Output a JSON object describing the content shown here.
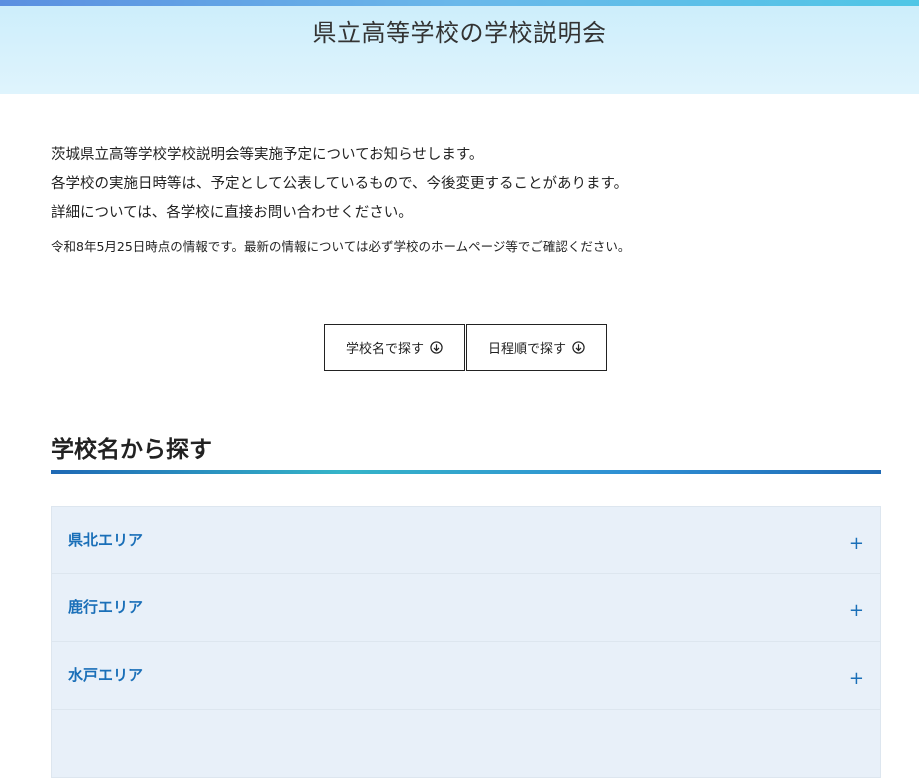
{
  "header": {
    "title": "県立高等学校の学校説明会"
  },
  "intro": {
    "line1": "茨城県立高等学校学校説明会等実施予定についてお知らせします。",
    "line2": "各学校の実施日時等は、予定として公表しているもので、今後変更することがあります。",
    "line3": "詳細については、各学校に直接お問い合わせください。",
    "note": "令和8年5月25日時点の情報です。最新の情報については必ず学校のホームページ等でご確認ください。"
  },
  "buttons": {
    "by_name": "学校名で探す",
    "by_schedule": "日程順で探す"
  },
  "section": {
    "title": "学校名から探す"
  },
  "accordion": {
    "items": [
      {
        "label": "県北エリア",
        "toggle": "+"
      },
      {
        "label": "鹿行エリア",
        "toggle": "+"
      },
      {
        "label": "水戸エリア",
        "toggle": "+"
      },
      {
        "label": "",
        "toggle": ""
      }
    ]
  },
  "colors": {
    "accent": "#1a6fb8",
    "header_bg": "#d6f1fc",
    "accordion_bg": "#e8f0f9"
  }
}
